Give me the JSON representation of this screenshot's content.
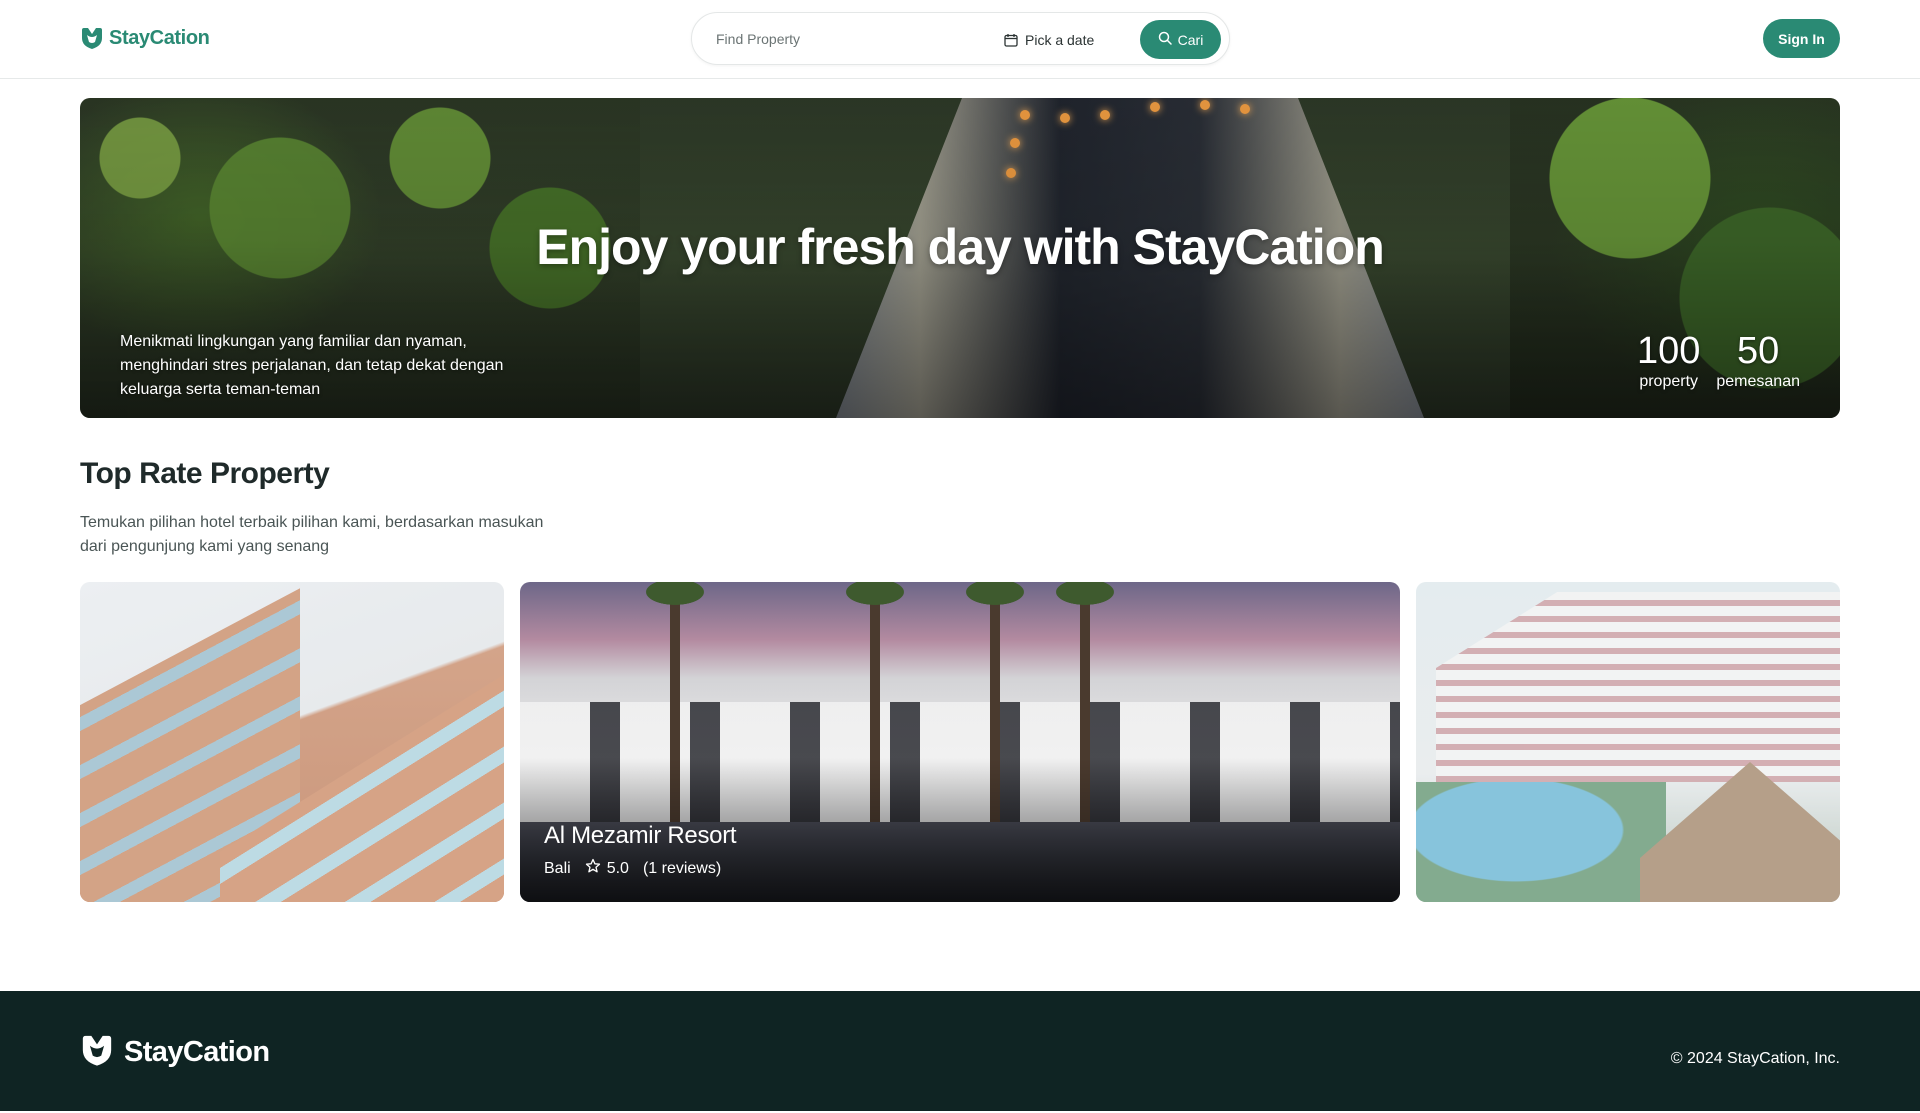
{
  "header": {
    "brand": "StayCation",
    "search": {
      "placeholder": "Find Property",
      "date_label": "Pick a date",
      "button_label": "Cari"
    },
    "sign_in_label": "Sign In"
  },
  "hero": {
    "title": "Enjoy your fresh day with StayCation",
    "description": "Menikmati lingkungan yang familiar dan nyaman, menghindari stres perjalanan, dan tetap dekat dengan keluarga serta teman-teman",
    "stats": [
      {
        "value": "100",
        "label": "property"
      },
      {
        "value": "50",
        "label": "pemesanan"
      }
    ]
  },
  "top_rate": {
    "title": "Top Rate Property",
    "description": "Temukan pilihan hotel terbaik pilihan kami, berdasarkan masukan dari pengunjung kami yang senang",
    "featured": {
      "name": "Al Mezamir Resort",
      "location": "Bali",
      "rating": "5.0",
      "reviews": "(1 reviews)"
    }
  },
  "footer": {
    "brand": "StayCation",
    "copyright": "© 2024 StayCation, Inc."
  },
  "colors": {
    "brand": "#2a8a74",
    "footer_bg": "#0f2423"
  }
}
